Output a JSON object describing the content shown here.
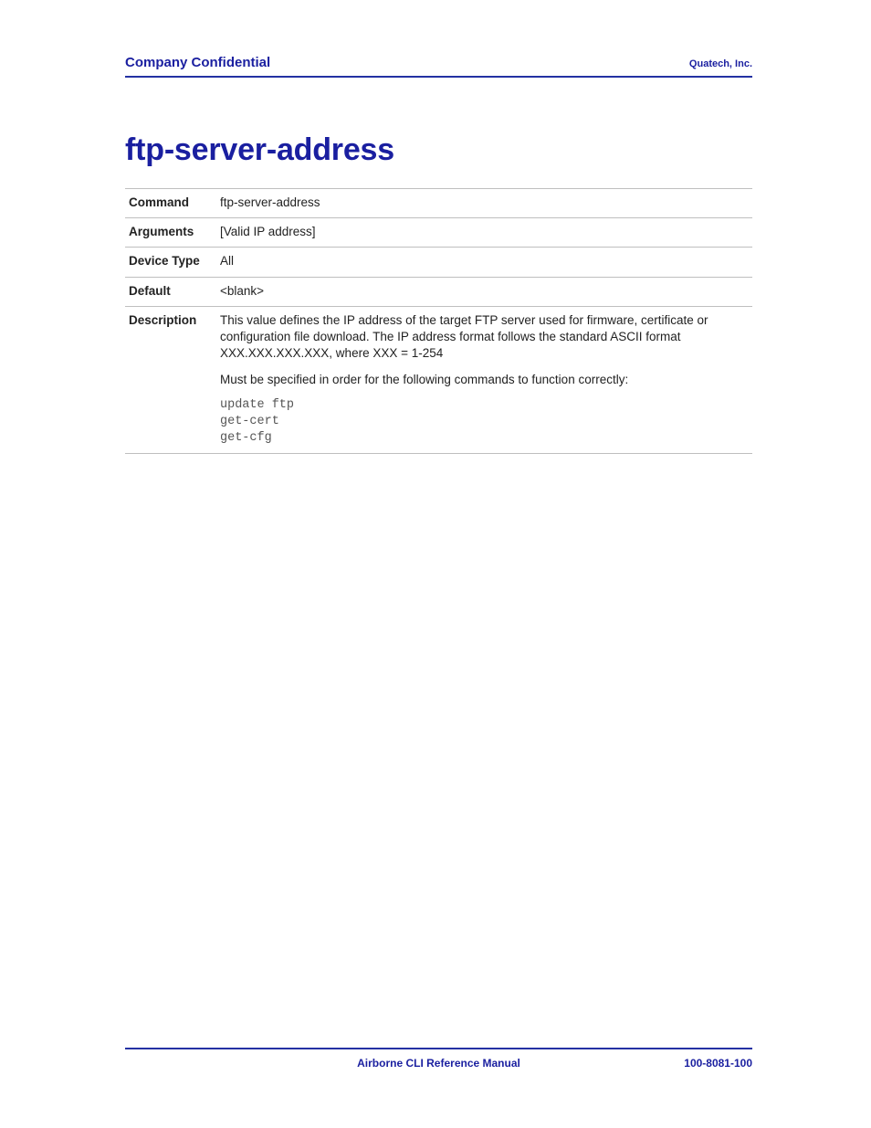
{
  "header": {
    "left": "Company Confidential",
    "right": "Quatech, Inc."
  },
  "title": "ftp-server-address",
  "rows": {
    "command": {
      "label": "Command",
      "value": "ftp-server-address"
    },
    "arguments": {
      "label": "Arguments",
      "value": "[Valid IP address]"
    },
    "device_type": {
      "label": "Device Type",
      "value": "All"
    },
    "default": {
      "label": "Default",
      "value": "<blank>"
    },
    "description": {
      "label": "Description",
      "para1": "This value defines the IP address of the target FTP server used for firmware, certificate or configuration file download. The IP address format follows the standard ASCII format XXX.XXX.XXX.XXX, where XXX = 1-254",
      "para2": "Must be specified in order for the following commands to function correctly:",
      "cmd1": "update ftp",
      "cmd2": "get-cert",
      "cmd3": "get-cfg"
    }
  },
  "footer": {
    "center": "Airborne CLI Reference Manual",
    "right": "100-8081-100"
  }
}
